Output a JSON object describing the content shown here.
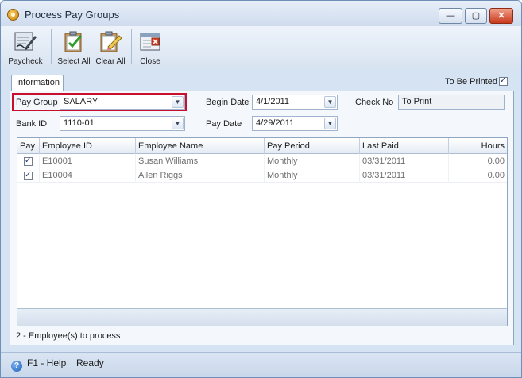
{
  "window": {
    "title": "Process Pay Groups"
  },
  "toolbar": {
    "paycheck": "Paycheck",
    "select_all": "Select All",
    "clear_all": "Clear All",
    "close": "Close"
  },
  "tab": {
    "label": "Information"
  },
  "to_be_printed": {
    "label": "To Be Printed",
    "checked": true
  },
  "form": {
    "pay_group_label": "Pay Group",
    "pay_group_value": "SALARY",
    "bank_id_label": "Bank ID",
    "bank_id_value": "1110-01",
    "begin_date_label": "Begin Date",
    "begin_date_value": "4/1/2011",
    "pay_date_label": "Pay Date",
    "pay_date_value": "4/29/2011",
    "check_no_label": "Check No",
    "check_no_value": "To Print"
  },
  "grid": {
    "columns": [
      "Pay",
      "Employee ID",
      "Employee Name",
      "Pay Period",
      "Last Paid",
      "Hours"
    ],
    "rows": [
      {
        "pay": true,
        "employee_id": "E10001",
        "employee_name": "Susan Williams",
        "pay_period": "Monthly",
        "last_paid": "03/31/2011",
        "hours": "0.00"
      },
      {
        "pay": true,
        "employee_id": "E10004",
        "employee_name": "Allen Riggs",
        "pay_period": "Monthly",
        "last_paid": "03/31/2011",
        "hours": "0.00"
      }
    ]
  },
  "summary": {
    "process_count": "2 -  Employee(s) to process"
  },
  "status": {
    "help": "F1 - Help",
    "state": "Ready"
  },
  "icons": {
    "tick": "✓",
    "dropdown": "▼",
    "help": "?",
    "minimize": "—",
    "maximize": "▢",
    "close": "✕"
  },
  "colors": {
    "highlight": "#c8102e",
    "frame": "#d6e3f2"
  }
}
